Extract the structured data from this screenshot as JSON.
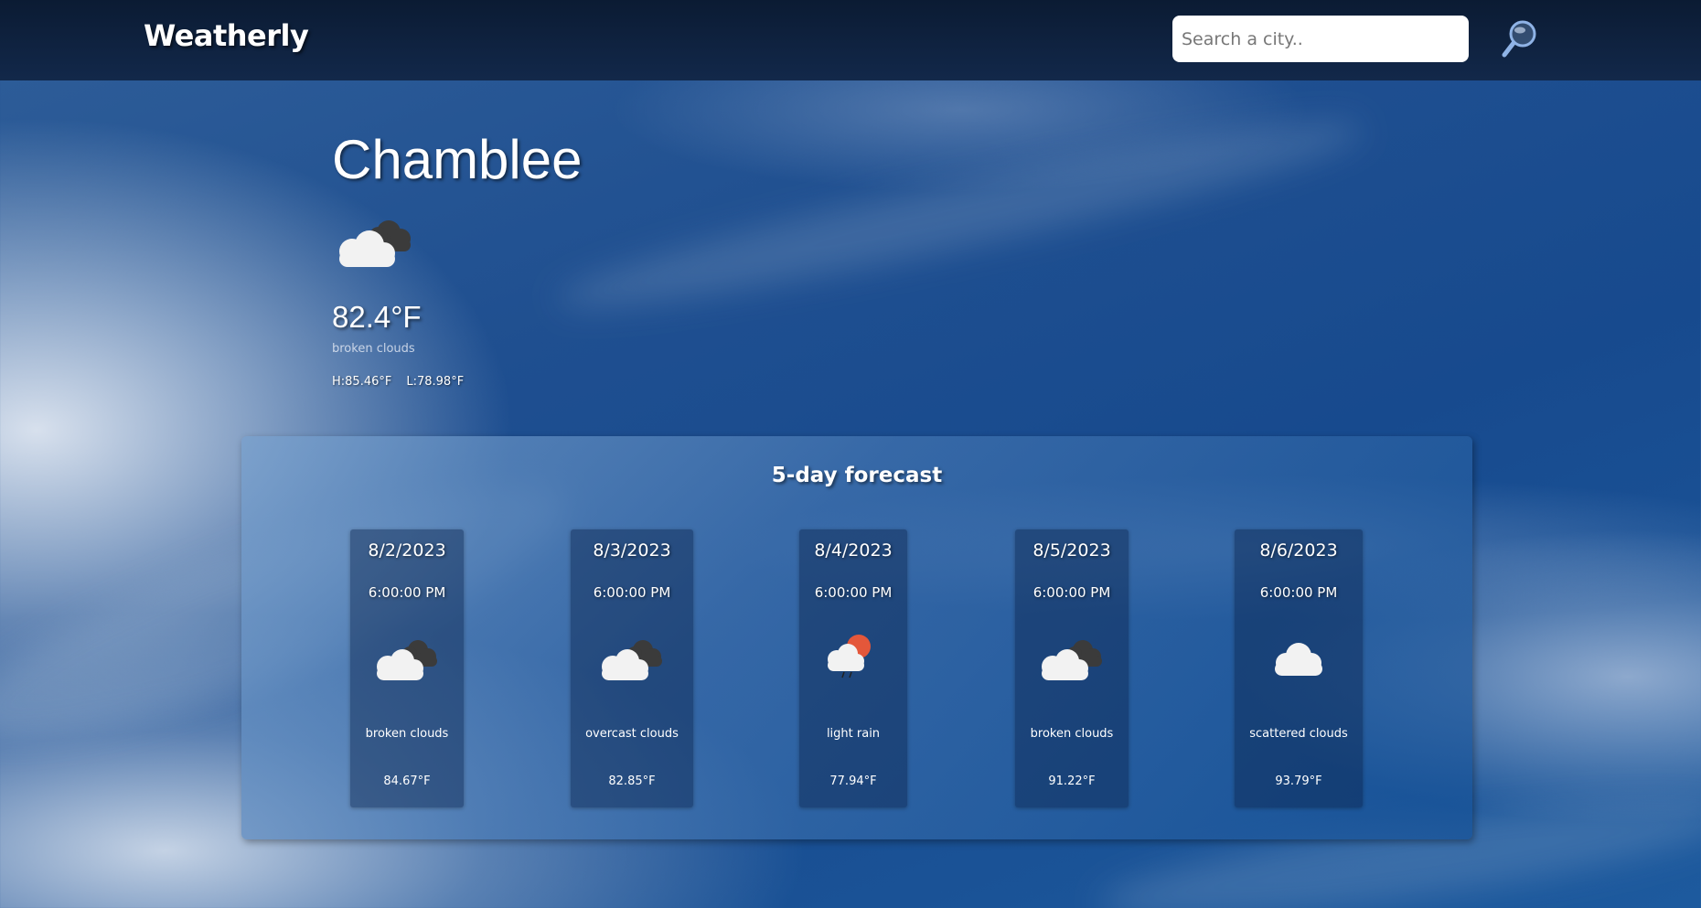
{
  "app": {
    "brand": "Weatherly"
  },
  "search": {
    "placeholder": "Search a city..",
    "button_icon": "search-icon"
  },
  "current": {
    "city": "Chamblee",
    "icon": "broken-clouds-icon",
    "temperature": "82.4°F",
    "description": "broken clouds",
    "high": "H:85.46°F",
    "low": "L:78.98°F"
  },
  "forecast": {
    "title": "5-day forecast",
    "days": [
      {
        "date": "8/2/2023",
        "time": "6:00:00 PM",
        "icon": "broken-clouds-icon",
        "description": "broken clouds",
        "temp": "84.67°F"
      },
      {
        "date": "8/3/2023",
        "time": "6:00:00 PM",
        "icon": "overcast-clouds-icon",
        "description": "overcast clouds",
        "temp": "82.85°F"
      },
      {
        "date": "8/4/2023",
        "time": "6:00:00 PM",
        "icon": "light-rain-icon",
        "description": "light rain",
        "temp": "77.94°F"
      },
      {
        "date": "8/5/2023",
        "time": "6:00:00 PM",
        "icon": "broken-clouds-icon",
        "description": "broken clouds",
        "temp": "91.22°F"
      },
      {
        "date": "8/6/2023",
        "time": "6:00:00 PM",
        "icon": "scattered-clouds-icon",
        "description": "scattered clouds",
        "temp": "93.79°F"
      }
    ]
  },
  "colors": {
    "header_bg": "#0b1b33",
    "sky": "#1f4f90",
    "sun": "#e4573a"
  }
}
